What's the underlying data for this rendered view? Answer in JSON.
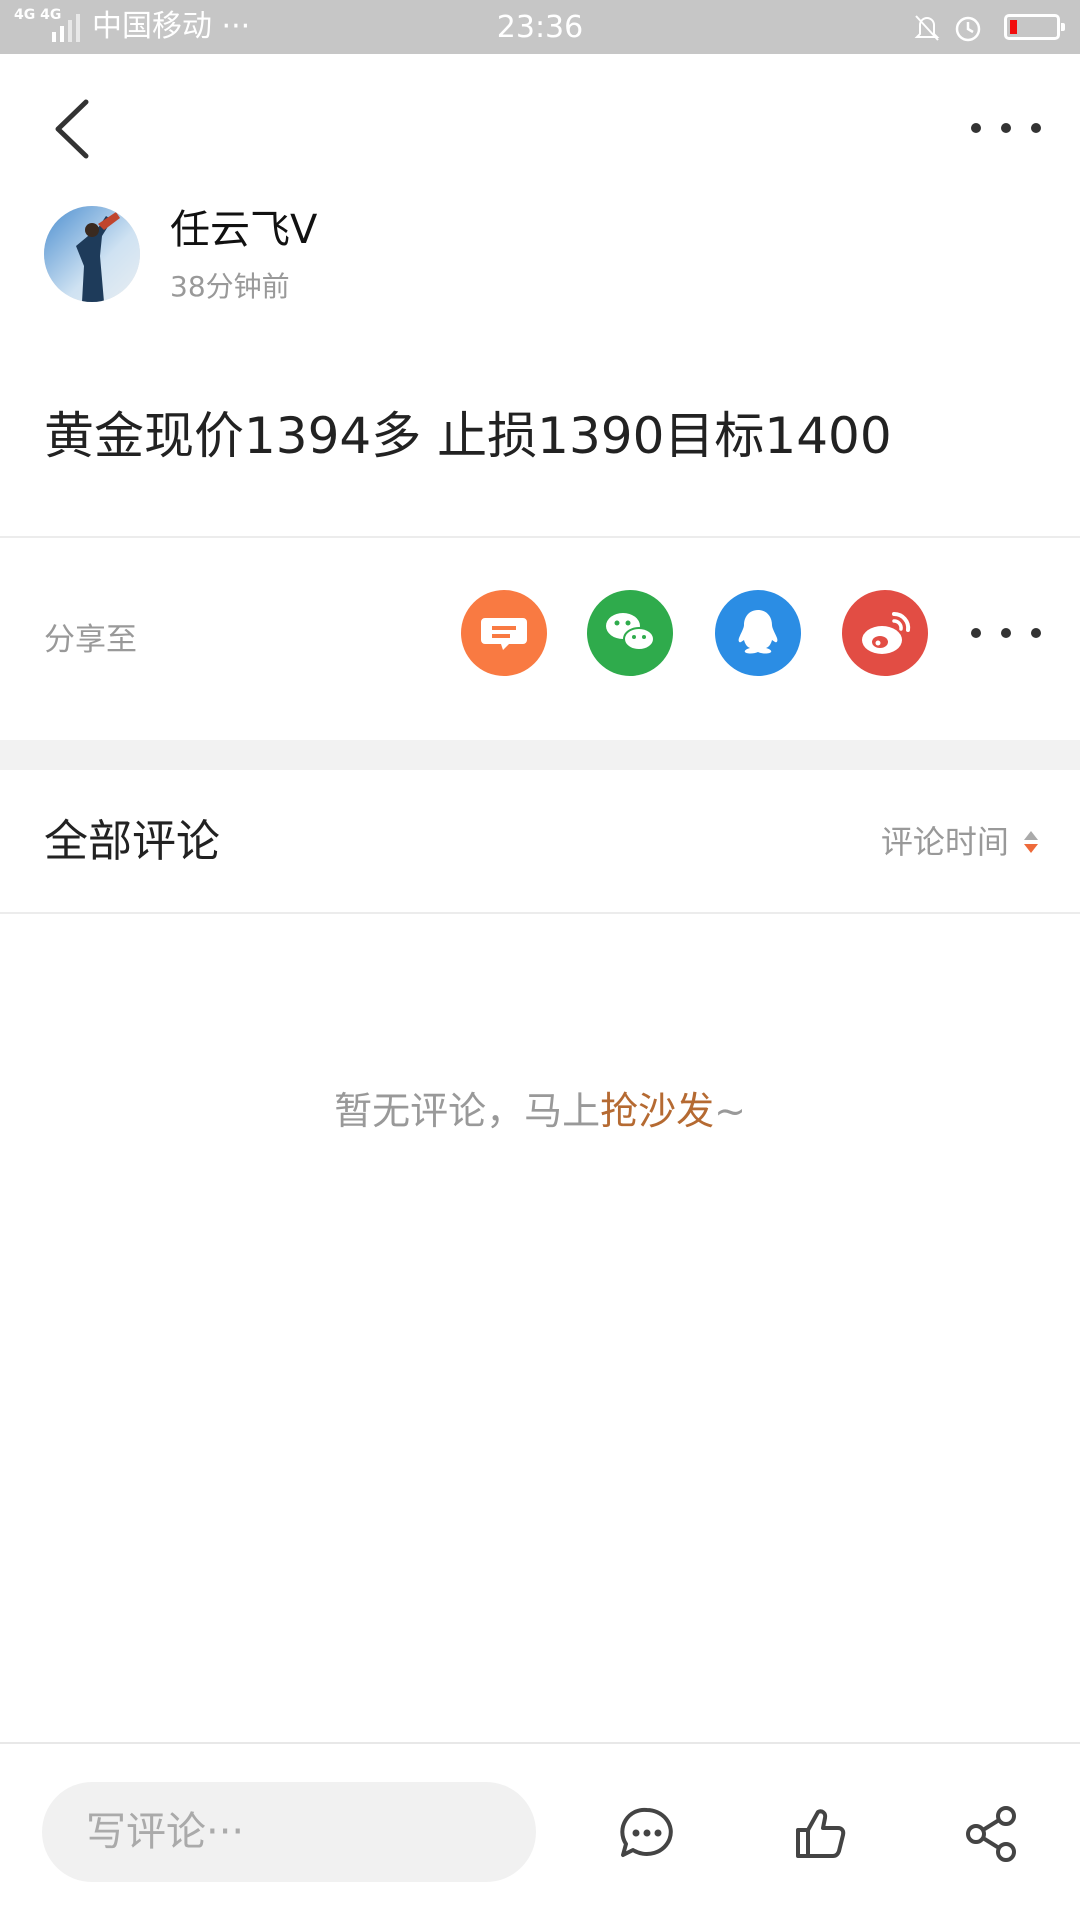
{
  "status_bar": {
    "network": "4G 4G",
    "carrier": "中国移动 ···",
    "time": "23:36",
    "battery_color": "#f20c0c"
  },
  "nav": {
    "back_icon": "chevron-left-icon",
    "more_icon": "more-dots-icon"
  },
  "post": {
    "author_name": "任云飞V",
    "time_ago": "38分钟前",
    "content": "黄金现价1394多 止损1390目标1400"
  },
  "share": {
    "label": "分享至",
    "targets": [
      {
        "name": "message-icon",
        "color": "#f97a42"
      },
      {
        "name": "wechat-icon",
        "color": "#2fab4c"
      },
      {
        "name": "qq-icon",
        "color": "#2b8de4"
      },
      {
        "name": "weibo-icon",
        "color": "#e24d44"
      }
    ]
  },
  "comments": {
    "title": "全部评论",
    "sort_label": "评论时间",
    "sort_accent": "#ee6a3a",
    "empty_prefix": "暂无评论，马上",
    "empty_link": "抢沙发",
    "empty_suffix": "~"
  },
  "bottom_bar": {
    "placeholder": "写评论···",
    "icons": [
      "comment-icon",
      "like-icon",
      "share-icon"
    ]
  }
}
